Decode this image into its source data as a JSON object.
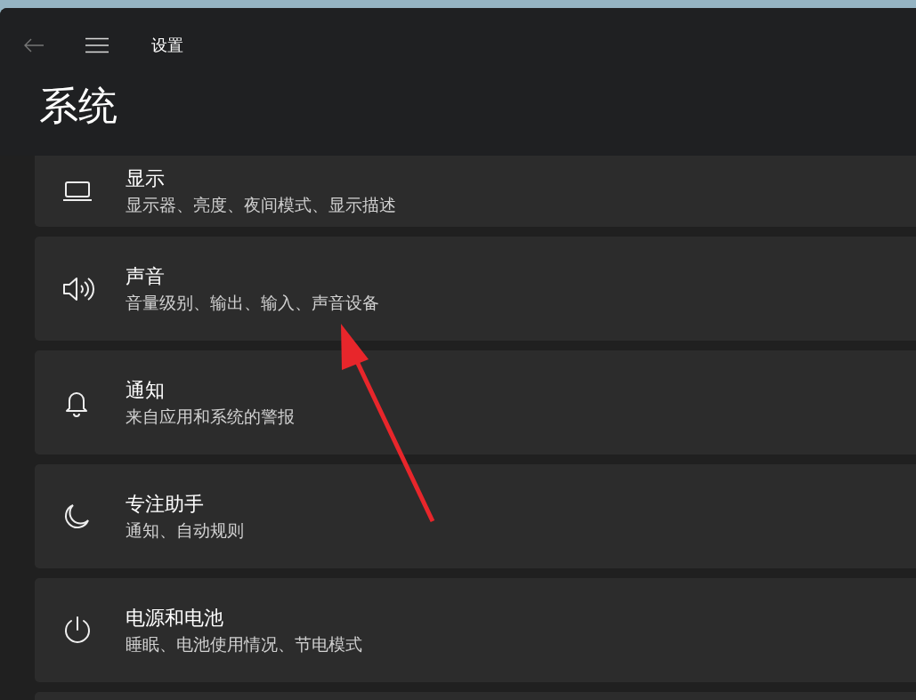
{
  "window": {
    "title": "设置"
  },
  "page_title": "系统",
  "items": [
    {
      "kind": "display",
      "title": "显示",
      "subtitle": "显示器、亮度、夜间模式、显示描述"
    },
    {
      "kind": "sound",
      "title": "声音",
      "subtitle": "音量级别、输出、输入、声音设备"
    },
    {
      "kind": "notifications",
      "title": "通知",
      "subtitle": "来自应用和系统的警报"
    },
    {
      "kind": "focus",
      "title": "专注助手",
      "subtitle": "通知、自动规则"
    },
    {
      "kind": "power",
      "title": "电源和电池",
      "subtitle": "睡眠、电池使用情况、节电模式"
    }
  ]
}
